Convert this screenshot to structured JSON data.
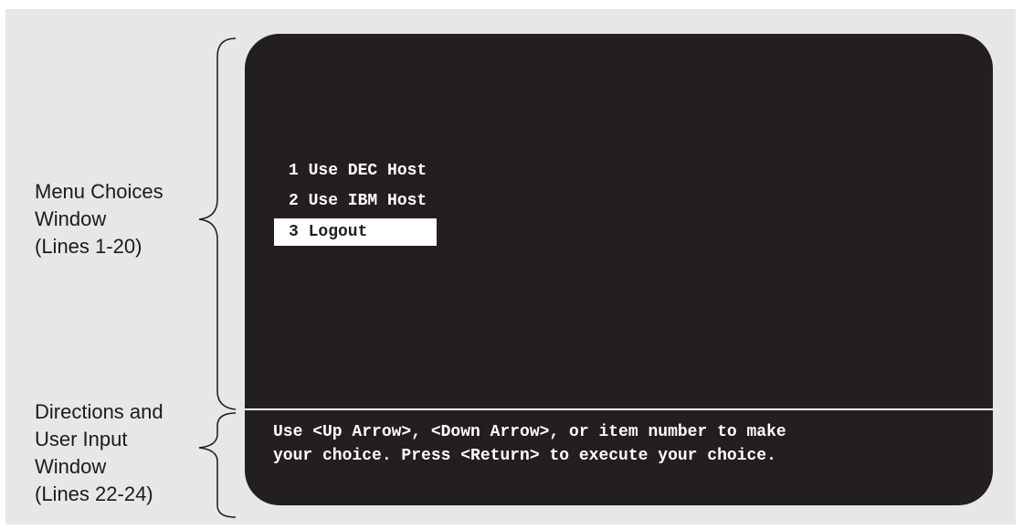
{
  "annotations": {
    "menu_window_label": "Menu Choices\nWindow\n(Lines 1-20)",
    "input_window_label": "Directions and\nUser Input\nWindow\n(Lines 22-24)"
  },
  "menu": {
    "items": [
      {
        "label": "1 Use DEC Host",
        "selected": false
      },
      {
        "label": "2 Use IBM Host",
        "selected": false
      },
      {
        "label": "3 Logout",
        "selected": true
      }
    ]
  },
  "directions": {
    "text": "Use <Up Arrow>, <Down Arrow>, or item number to make\nyour choice. Press <Return> to execute your choice."
  },
  "colors": {
    "screen_background": "#231f20",
    "screen_text": "#ffffff",
    "figure_background": "#e6e7e8"
  }
}
